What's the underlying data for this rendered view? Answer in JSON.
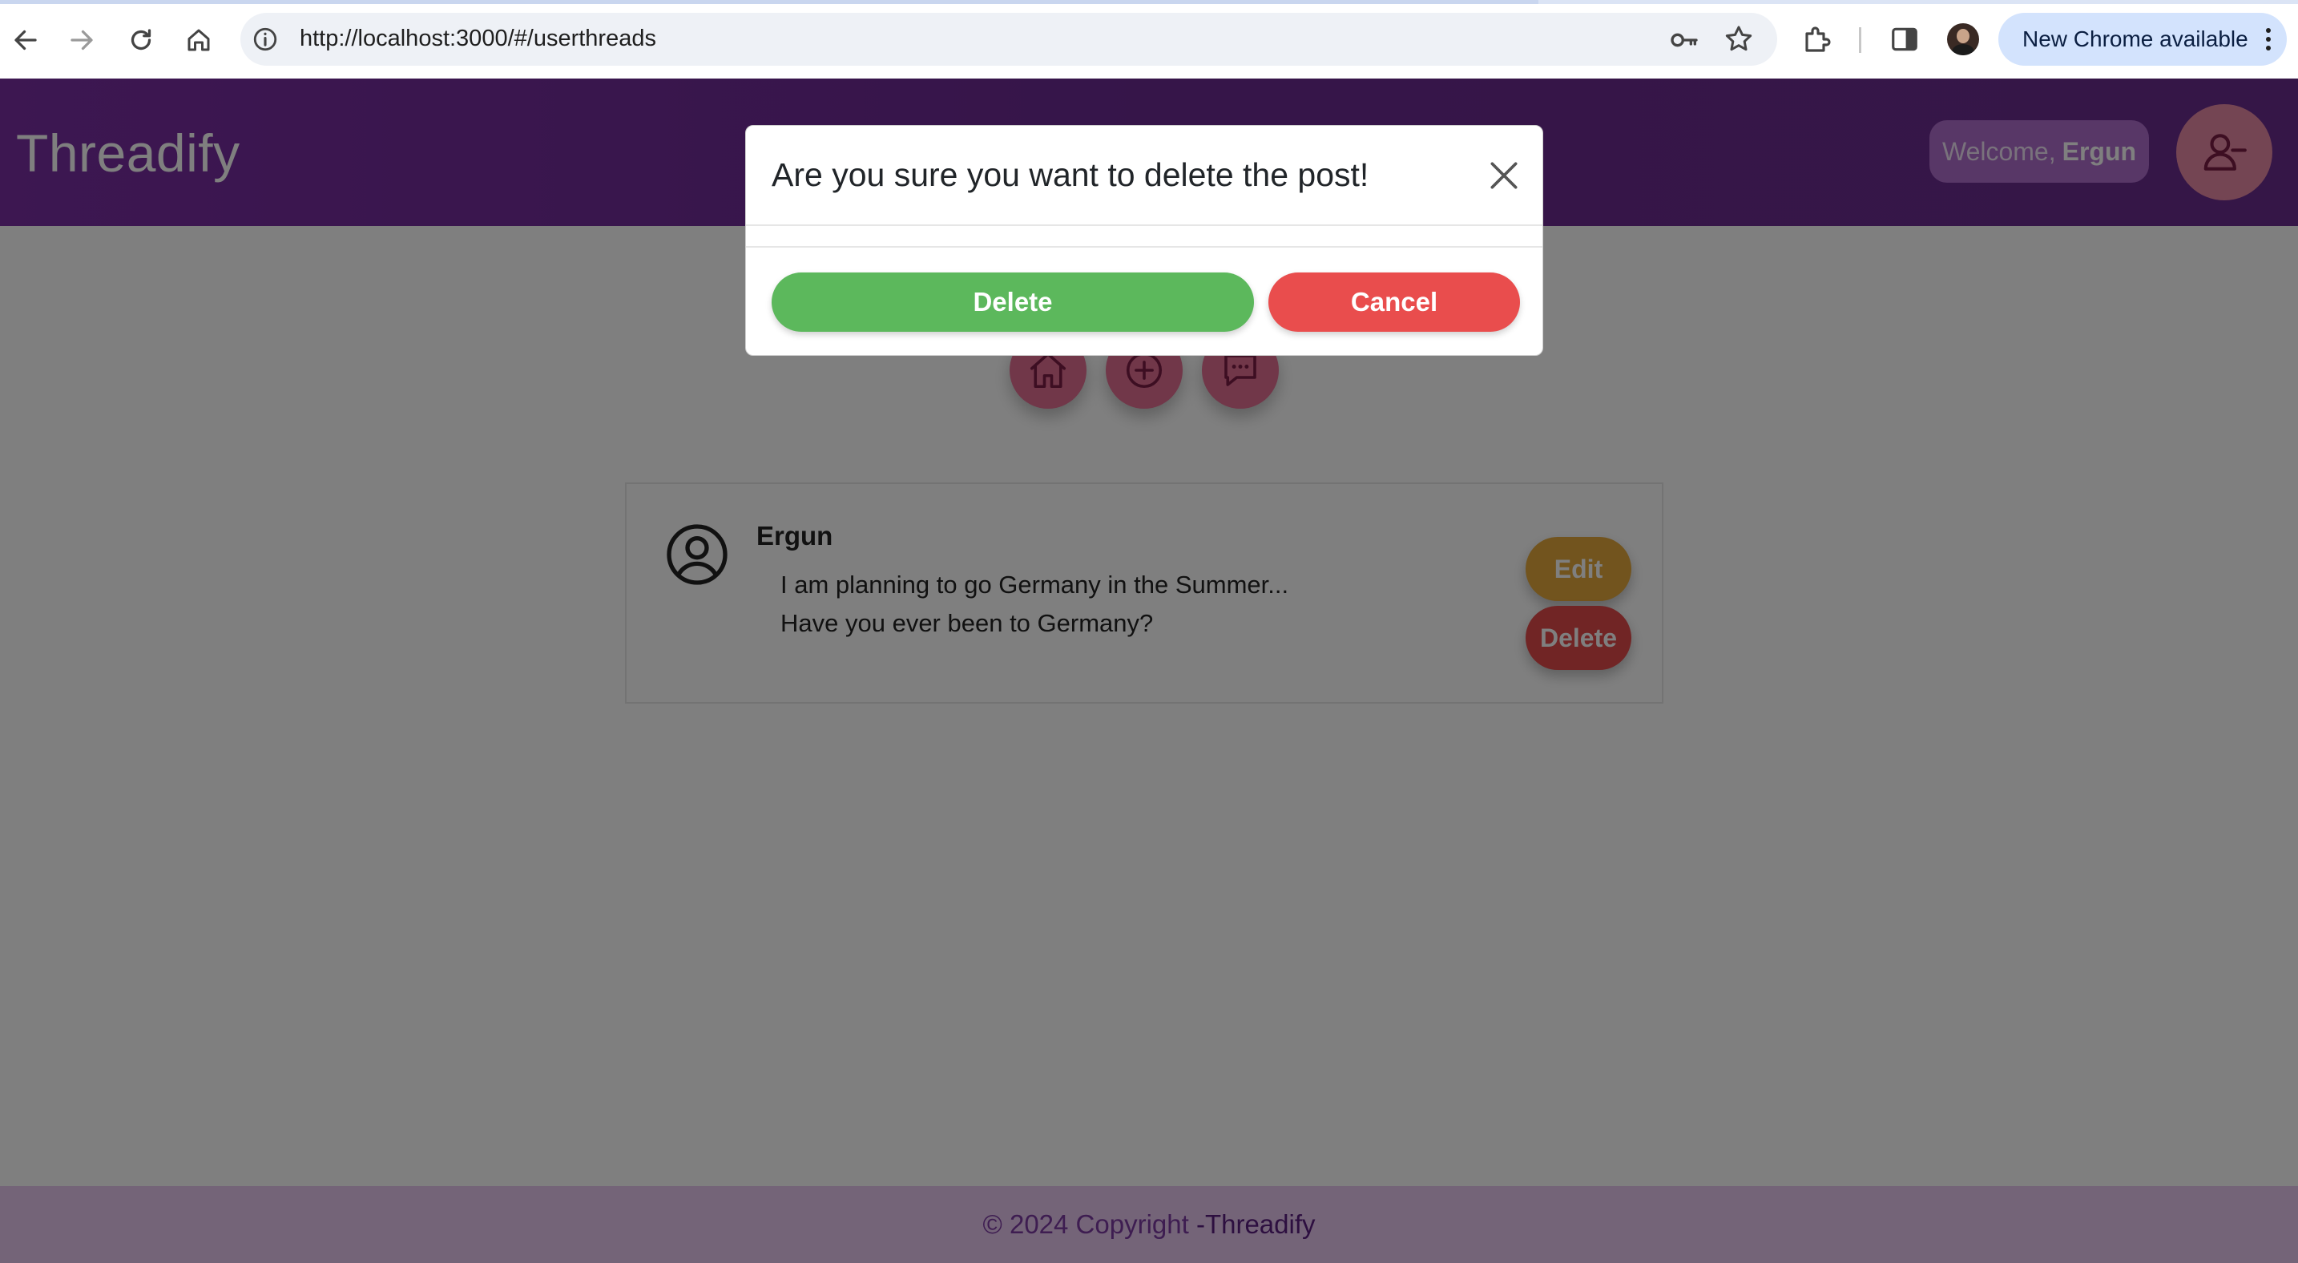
{
  "browser": {
    "url": "http://localhost:3000/#/userthreads",
    "update_label": "New Chrome available"
  },
  "app": {
    "brand": "Threadify",
    "welcome_prefix": "Welcome,",
    "username": "Ergun",
    "colors": {
      "header": "#7a2ea3",
      "fab": "#e36f93",
      "edit": "#e5a83c",
      "delete": "#e24a4a",
      "footer_bg": "#e8c8f0"
    }
  },
  "nav_icons": [
    "home-icon",
    "add-circle-icon",
    "chat-icon"
  ],
  "post": {
    "author": "Ergun",
    "body": "I am planning to go Germany in the Summer... Have you ever been to Germany?",
    "edit_label": "Edit",
    "delete_label": "Delete"
  },
  "footer": {
    "copyright": "© 2024 Copyright",
    "brand": "-Threadify"
  },
  "modal": {
    "title": "Are you sure you want to delete the post!",
    "confirm_label": "Delete",
    "cancel_label": "Cancel",
    "colors": {
      "confirm": "#5cb85c",
      "cancel": "#e94d4d"
    }
  }
}
